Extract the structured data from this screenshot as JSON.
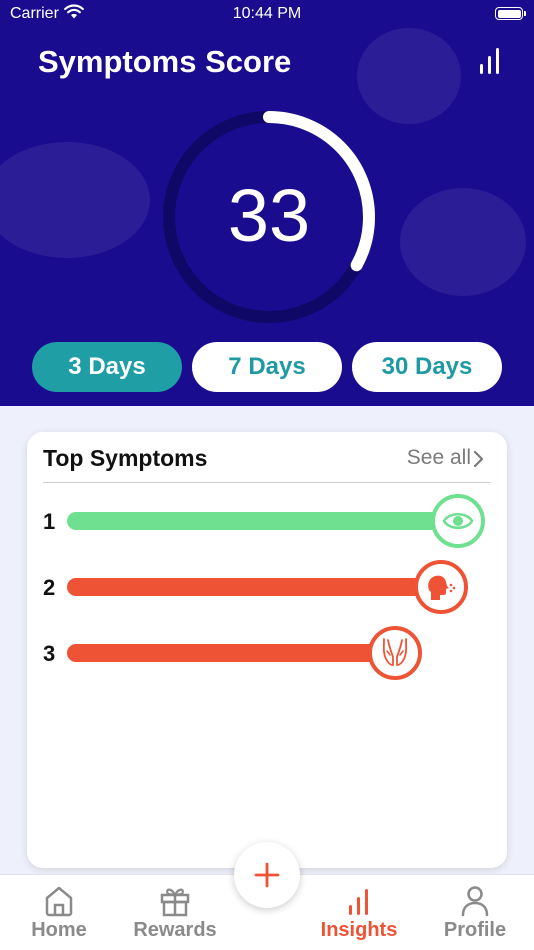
{
  "status_bar": {
    "carrier": "Carrier",
    "time": "10:44 PM"
  },
  "header": {
    "title": "Symptoms Score"
  },
  "gauge": {
    "score": "33",
    "progress": 0.33
  },
  "ranges": [
    {
      "label": "3 Days",
      "active": true
    },
    {
      "label": "7 Days",
      "active": false
    },
    {
      "label": "30 Days",
      "active": false
    }
  ],
  "top_symptoms": {
    "title": "Top Symptoms",
    "see_all": "See all",
    "items": [
      {
        "rank": "1",
        "icon": "eye-icon",
        "color": "#6ee08f",
        "level": 0.93
      },
      {
        "rank": "2",
        "icon": "cough-icon",
        "color": "#ee5335",
        "level": 0.89
      },
      {
        "rank": "3",
        "icon": "hands-icon",
        "color": "#ee5335",
        "level": 0.78
      }
    ]
  },
  "tabbar": {
    "tabs": [
      {
        "label": "Home",
        "icon": "home-icon"
      },
      {
        "label": "Rewards",
        "icon": "gift-icon"
      },
      {
        "label": "Insights",
        "icon": "chart-icon",
        "active": true
      },
      {
        "label": "Profile",
        "icon": "person-icon"
      }
    ],
    "add_icon": "plus-icon"
  },
  "colors": {
    "header_bg": "#1a0c8f",
    "accent_teal": "#1f9ea6",
    "accent_red": "#ee5335",
    "green": "#6ee08f"
  }
}
